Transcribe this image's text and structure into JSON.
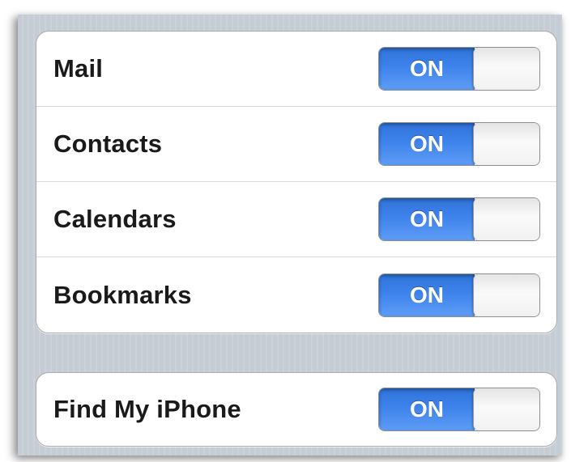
{
  "settings": {
    "sync_items": [
      {
        "label": "Mail",
        "toggle_text": "ON",
        "enabled": true
      },
      {
        "label": "Contacts",
        "toggle_text": "ON",
        "enabled": true
      },
      {
        "label": "Calendars",
        "toggle_text": "ON",
        "enabled": true
      },
      {
        "label": "Bookmarks",
        "toggle_text": "ON",
        "enabled": true
      }
    ],
    "find_my_iphone": {
      "label": "Find My iPhone",
      "toggle_text": "ON",
      "enabled": true
    }
  },
  "colors": {
    "toggle_on_blue": "#3e83ec",
    "background": "#c5ccd4",
    "cell_background": "#ffffff",
    "label_text": "#1a1a1a"
  }
}
